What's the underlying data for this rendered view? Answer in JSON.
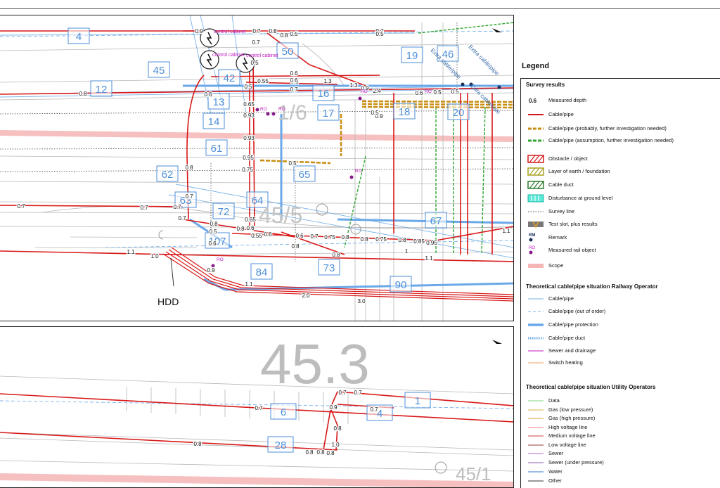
{
  "colors": {
    "cable_red": "#d81818",
    "probable_orange": "#d59a18",
    "assumed_green": "#2fa52f",
    "railway_blue": "#6aa8e8",
    "scope_pink": "#f5b5b5",
    "remark_dark": "#1a2f5a",
    "rail_object_magenta": "#c018c0",
    "plan_label_blue": "#4d8fd8",
    "grid_gray": "#a8a8a8"
  },
  "map_top": {
    "depths": [
      "0.9",
      "0.7",
      "0.8",
      "0.8",
      "0.5",
      "0.7",
      "0.5",
      "0.7",
      "0.8",
      "0.6",
      "0.5",
      "0.6",
      "0.5",
      "0.55",
      "0.6",
      "0.5",
      "0.7",
      "1.3",
      "1.3",
      "0.9",
      "2.4",
      "0.5",
      "0.5",
      "0.6",
      "0.9",
      "0.8",
      "0.65",
      "0.93",
      "0.5",
      "0.93",
      "0.95",
      "0.5",
      "0.75",
      "0.8",
      "0.7",
      "0.7",
      "0.7",
      "0.7",
      "0.7",
      "0.5",
      "0.6",
      "0.8",
      "0.65",
      "0.6",
      "0.55",
      "0.6",
      "0.6",
      "0.7",
      "0.75",
      "0.8",
      "0.8",
      "0.75",
      "0.8",
      "0.85",
      "0.95",
      "0.8",
      "0.8",
      "1",
      "1.1",
      "1.1",
      "1.0",
      "1.1",
      "0.9",
      "1.1",
      "2.0",
      "3.0"
    ],
    "plan_labels": [
      "4",
      "45",
      "12",
      "42",
      "50",
      "13",
      "14",
      "16",
      "17",
      "18",
      "19",
      "46",
      "20",
      "61",
      "62",
      "63",
      "64",
      "65",
      "72",
      "107",
      "67",
      "73",
      "84",
      "90"
    ],
    "faint_labels": [
      "1/6",
      "45/5"
    ],
    "cabinet_labels": [
      "control cabinet",
      "control cabinet",
      "control cabinet"
    ],
    "extra_labels": [
      "Extra cable/pipe",
      "Extra cable/pipe",
      "Extra cable/pipe"
    ],
    "ro_labels": [
      "RO",
      "RO",
      "RO",
      "RO",
      "RO",
      "RO"
    ],
    "hdd_label": "HDD"
  },
  "map_bottom": {
    "km_label": "45.3",
    "km_label_2": "45/1",
    "depths": [
      "0.7",
      "0.7",
      "0.7",
      "0.9",
      "0.7",
      "0.8",
      "0.8",
      "1.0",
      "0.8",
      "0.8",
      "0.8"
    ],
    "plan_labels": [
      "6",
      "4",
      "1",
      "28"
    ]
  },
  "legend": {
    "title": "Legend",
    "survey_results": {
      "title": "Survey results",
      "depth_sample": "0.6",
      "items": [
        "Measured depth",
        "Cable/pipe",
        "Cable/pipe (probably, further investigation needed)",
        "Cable/pipe (assumption, further investigation needed)",
        "Obstacle / object",
        "Layer of earth / foundation",
        "Cable duct",
        "Disturbance at ground level",
        "Survey line",
        "Test slot, plus results",
        "Remark",
        "Measured rail object",
        "Scope"
      ],
      "rm_symbol": "RM",
      "ro_symbol": "RO"
    },
    "railway": {
      "title": "Theoretical cable/pipe situation Railway Operator",
      "items": [
        "Cable/pipe",
        "Cable/pipe (out of order)",
        "Cable/pipe protection",
        "Cable/pipe duct",
        "Sewer and drainage",
        "Switch heating"
      ]
    },
    "utility": {
      "title": "Theoretical cable/pipe situation Utility Operators",
      "items": [
        "Data",
        "Gas (low pressure)",
        "Gas (high pressure)",
        "High voltage line",
        "Medium voltage line",
        "Low voltage line",
        "Sewer",
        "Sewer (under pressure)",
        "Water",
        "Other"
      ],
      "colors": [
        "#7fd37f",
        "#d9b14a",
        "#e0a040",
        "#f08080",
        "#d04040",
        "#9a3a3a",
        "#b06ad0",
        "#8a5ab0",
        "#3a7ad0",
        "#333333"
      ]
    }
  }
}
